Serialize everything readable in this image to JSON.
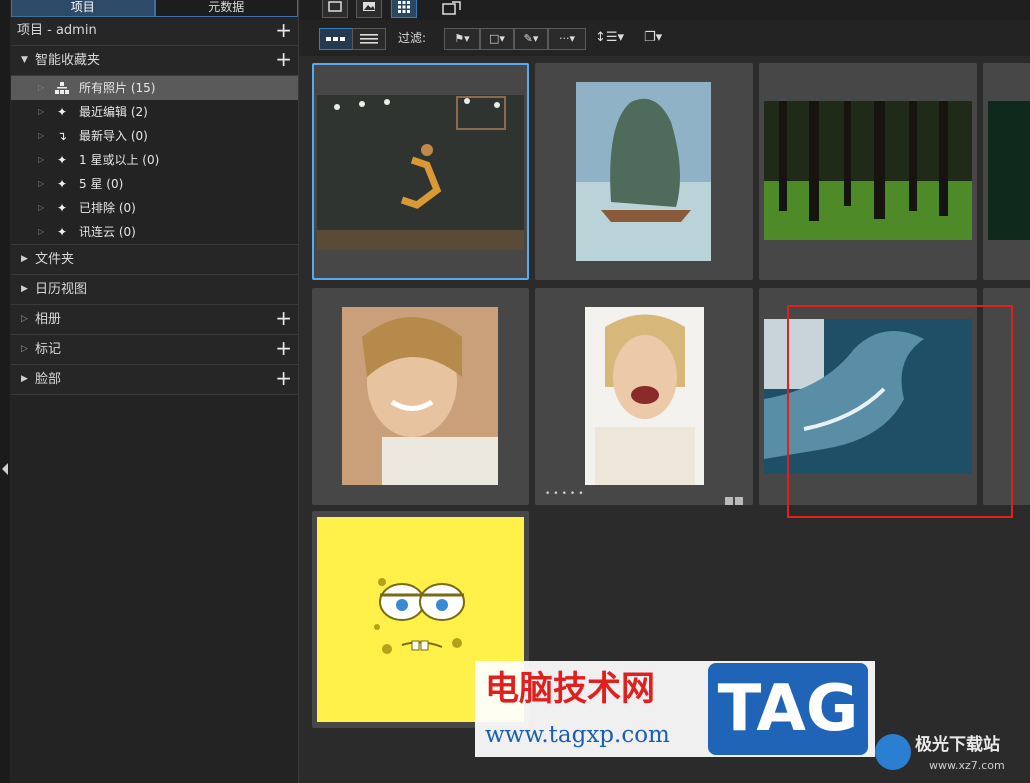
{
  "sidebar": {
    "tabs": [
      {
        "label": "项目"
      },
      {
        "label": "元数据"
      }
    ],
    "project_label": "项目 - admin",
    "smart_collections": {
      "title": "智能收藏夹",
      "items": [
        {
          "label": "所有照片 (15)"
        },
        {
          "label": "最近编辑 (2)"
        },
        {
          "label": "最新导入 (0)"
        },
        {
          "label": "1 星或以上 (0)"
        },
        {
          "label": "5 星 (0)"
        },
        {
          "label": "已排除 (0)"
        },
        {
          "label": "讯连云 (0)"
        }
      ]
    },
    "sections": [
      {
        "label": "文件夹"
      },
      {
        "label": "日历视图"
      },
      {
        "label": "相册"
      },
      {
        "label": "标记"
      },
      {
        "label": "脸部"
      }
    ]
  },
  "toolbar": {
    "filter_label": "过滤:"
  },
  "thumbnails": [
    {
      "subject": "basketball-player-dunk",
      "color": "#3a3f3a"
    },
    {
      "subject": "sea-rock-boat",
      "color": "#6b8fa8"
    },
    {
      "subject": "forest",
      "color": "#2e4a1f"
    },
    {
      "subject": "dark-green-partial",
      "color": "#0f2a1c"
    },
    {
      "subject": "smiling-woman",
      "color": "#d9b08c"
    },
    {
      "subject": "laughing-woman",
      "color": "#e8d6c2"
    },
    {
      "subject": "ocean-wave",
      "color": "#2c5f7a"
    },
    {
      "subject": "spongebob-face",
      "color": "#ffee4a"
    }
  ],
  "watermark": {
    "cn_text": "电脑技术网",
    "url": "www.tagxp.com",
    "tag": "TAG",
    "site2_name": "极光下载站",
    "site2_url": "www.xz7.com"
  },
  "colors": {
    "accent_blue": "#5aa9ef",
    "highlight_red": "#e0201e",
    "background": "#262626"
  }
}
